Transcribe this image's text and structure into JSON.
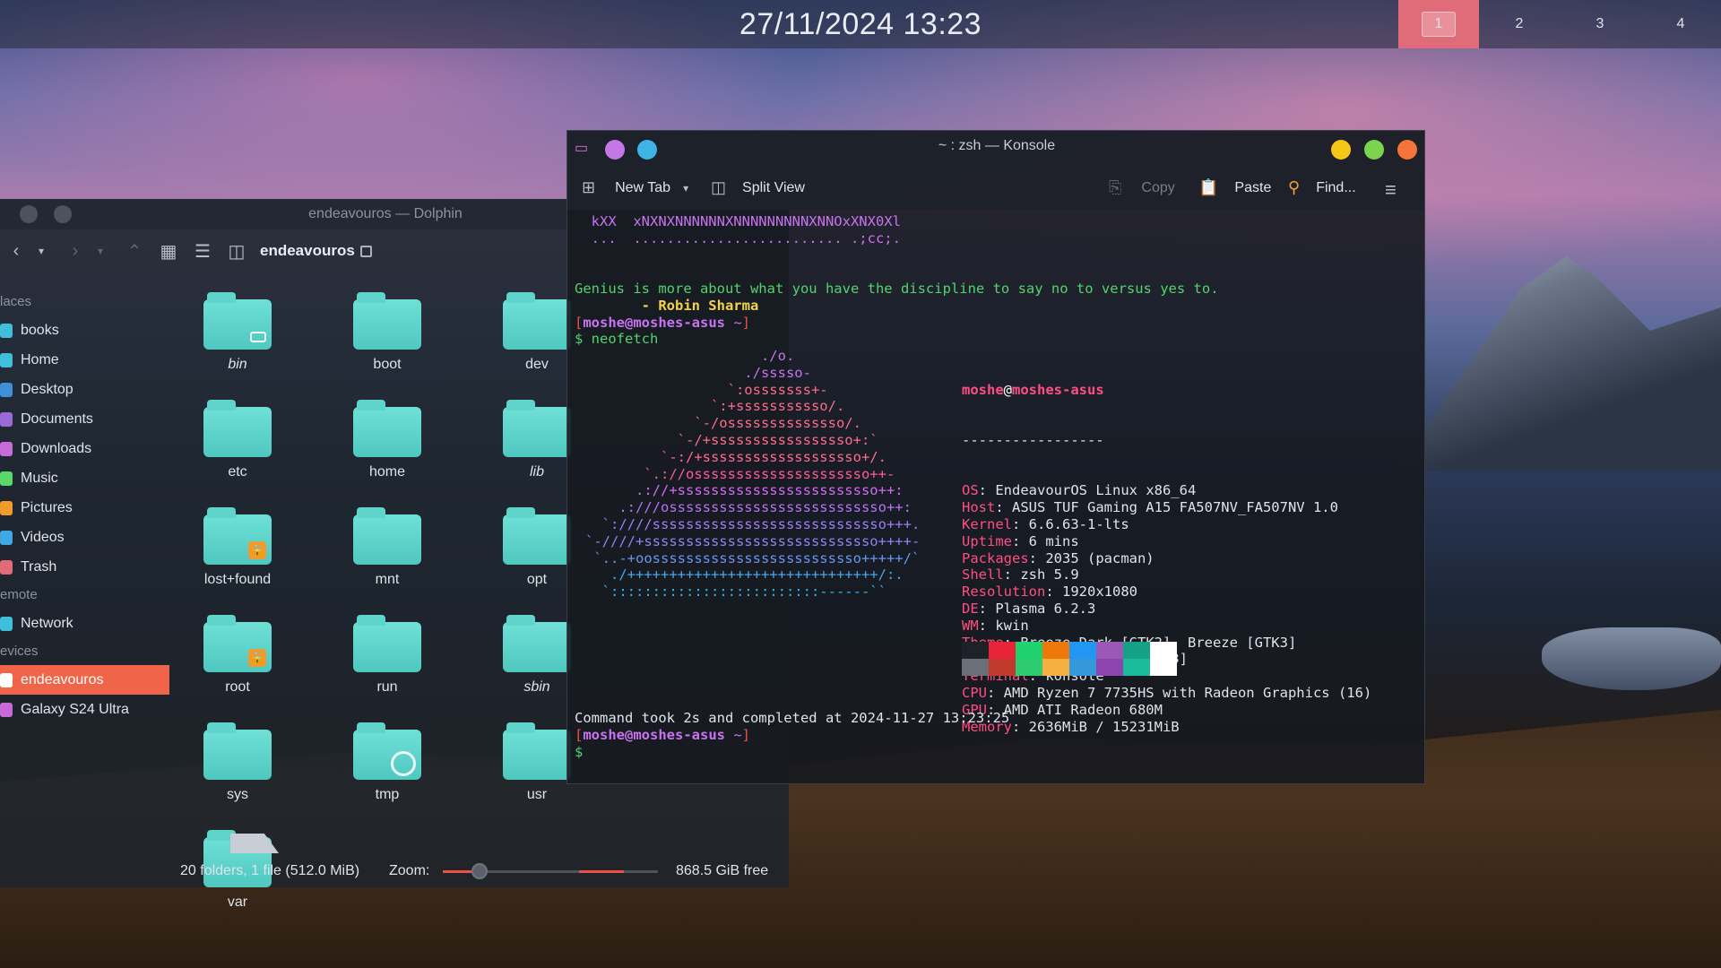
{
  "panel": {
    "clock": "27/11/2024 13:23",
    "desktops": [
      "1",
      "2",
      "3",
      "4"
    ]
  },
  "dolphin": {
    "title": "endeavouros — Dolphin",
    "breadcrumb": "endeavouros",
    "sidebar": {
      "places_header": "laces",
      "places": [
        {
          "label": "books",
          "color": "#3fbfd9"
        },
        {
          "label": "Home",
          "color": "#3fbfd9"
        },
        {
          "label": "Desktop",
          "color": "#3f8fd9"
        },
        {
          "label": "Documents",
          "color": "#9b6ad9"
        },
        {
          "label": "Downloads",
          "color": "#c86ad9"
        },
        {
          "label": "Music",
          "color": "#5ad96a"
        },
        {
          "label": "Pictures",
          "color": "#f39a2c"
        },
        {
          "label": "Videos",
          "color": "#3fa9e6"
        },
        {
          "label": "Trash",
          "color": "#e06c7a"
        }
      ],
      "remote_header": "emote",
      "remote": [
        {
          "label": "Network",
          "color": "#3fbfd9"
        }
      ],
      "devices_header": "evices",
      "devices": [
        {
          "label": "endeavouros",
          "color": "#ffffff"
        },
        {
          "label": "Galaxy S24 Ultra",
          "color": "#c86ad9"
        }
      ]
    },
    "folders": [
      {
        "name": "bin",
        "italic": true,
        "badge": "link"
      },
      {
        "name": "boot",
        "italic": false,
        "badge": ""
      },
      {
        "name": "dev",
        "italic": false,
        "badge": ""
      },
      {
        "name": "etc",
        "italic": false,
        "badge": ""
      },
      {
        "name": "home",
        "italic": false,
        "badge": ""
      },
      {
        "name": "lib",
        "italic": true,
        "badge": ""
      },
      {
        "name": "lost+found",
        "italic": false,
        "badge": "lock"
      },
      {
        "name": "mnt",
        "italic": false,
        "badge": ""
      },
      {
        "name": "opt",
        "italic": false,
        "badge": ""
      },
      {
        "name": "root",
        "italic": false,
        "badge": "lock"
      },
      {
        "name": "run",
        "italic": false,
        "badge": ""
      },
      {
        "name": "sbin",
        "italic": true,
        "badge": ""
      },
      {
        "name": "sys",
        "italic": false,
        "badge": ""
      },
      {
        "name": "tmp",
        "italic": false,
        "badge": "clock"
      },
      {
        "name": "usr",
        "italic": false,
        "badge": ""
      },
      {
        "name": "var",
        "italic": false,
        "badge": ""
      }
    ],
    "status": {
      "count": "20 folders, 1 file (512.0 MiB)",
      "zoom_label": "Zoom:",
      "free_space": "868.5 GiB free"
    }
  },
  "konsole": {
    "title": "~ : zsh — Konsole",
    "toolbar": {
      "new_tab": "New Tab",
      "split_view": "Split View",
      "copy": "Copy",
      "paste": "Paste",
      "find": "Find..."
    },
    "terminal": {
      "top_lines": [
        "  kXX  xNXNXNNNNNNXNNNNNNNNNXNNOxXNX0Xl",
        "  ...  ......................... .;cc;."
      ],
      "quote": "Genius is more about what you have the discipline to say no to versus yes to.",
      "author": "        - Robin Sharma",
      "prompt_user": "moshe@moshes-asus",
      "prompt_dir": "~",
      "command": "neofetch",
      "art": [
        "                     ./o.",
        "                   ./sssso-",
        "                 `:osssssss+-",
        "               `:+sssssssssso/.",
        "             `-/ossssssssssssso/.",
        "           `-/+sssssssssssssssso+:`",
        "         `-:/+sssssssssssssssssso+/.",
        "       `.://osssssssssssssssssssso++-",
        "      .://+ssssssssssssssssssssssso++:",
        "    .:///ossssssssssssssssssssssssso++:",
        "  `:////ssssssssssssssssssssssssssso+++.",
        "`-////+ssssssssssssssssssssssssssso++++-",
        " `..-+oosssssssssssssssssssssssso+++++/`",
        "   ./++++++++++++++++++++++++++++++/:.",
        "  `:::::::::::::::::::::::::------``"
      ],
      "nf_user": "moshe",
      "nf_host": "moshes-asus",
      "nf_sep": "-----------------",
      "info": [
        {
          "key": "OS",
          "value": "EndeavourOS Linux x86_64"
        },
        {
          "key": "Host",
          "value": "ASUS TUF Gaming A15 FA507NV_FA507NV 1.0"
        },
        {
          "key": "Kernel",
          "value": "6.6.63-1-lts"
        },
        {
          "key": "Uptime",
          "value": "6 mins"
        },
        {
          "key": "Packages",
          "value": "2035 (pacman)"
        },
        {
          "key": "Shell",
          "value": "zsh 5.9"
        },
        {
          "key": "Resolution",
          "value": "1920x1080"
        },
        {
          "key": "DE",
          "value": "Plasma 6.2.3"
        },
        {
          "key": "WM",
          "value": "kwin"
        },
        {
          "key": "Theme",
          "value": "Breeze-Dark [GTK2], Breeze [GTK3]"
        },
        {
          "key": "Icons",
          "value": "candy-icons [GTK2/3]"
        },
        {
          "key": "Terminal",
          "value": "konsole"
        },
        {
          "key": "CPU",
          "value": "AMD Ryzen 7 7735HS with Radeon Graphics (16)"
        },
        {
          "key": "GPU",
          "value": "AMD ATI Radeon 680M"
        },
        {
          "key": "Memory",
          "value": "2636MiB / 15231MiB"
        }
      ],
      "palette_top": [
        "#1e2228",
        "#e8243a",
        "#1ed36e",
        "#f0780a",
        "#2196f3",
        "#9b59b6",
        "#16a085",
        "#ffffff"
      ],
      "palette_bottom": [
        "#6b7078",
        "#c0392b",
        "#2ecc71",
        "#f5b041",
        "#3498db",
        "#8e44ad",
        "#1abc9c",
        "#ffffff"
      ],
      "completed": "Command took 2s and completed at 2024-11-27 13:23:25"
    }
  }
}
